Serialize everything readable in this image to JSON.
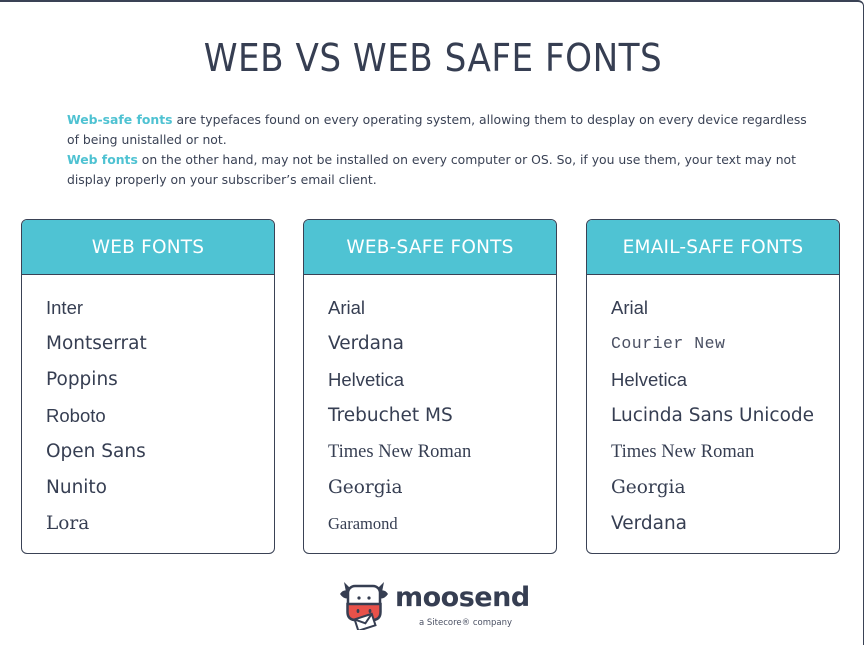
{
  "title": "WEB VS WEB SAFE FONTS",
  "intro": {
    "p1_highlight": "Web-safe fonts",
    "p1_text": " are typefaces found on every operating system, allowing them to desplay on every device regardless of being unistalled or not.",
    "p2_highlight": "Web fonts",
    "p2_text": " on the other hand, may not be installed on every computer or OS. So, if you use them, your text may not display properly on your subscriber’s email client."
  },
  "colors": {
    "accent": "#4fc3d3",
    "text": "#363e52",
    "logo_red": "#e8514a"
  },
  "cards": [
    {
      "heading": "WEB FONTS",
      "fonts": [
        "Inter",
        "Montserrat",
        "Poppins",
        "Roboto",
        "Open Sans",
        "Nunito",
        "Lora"
      ]
    },
    {
      "heading": "WEB-SAFE FONTS",
      "fonts": [
        "Arial",
        "Verdana",
        "Helvetica",
        "Trebuchet MS",
        "Times New Roman",
        "Georgia",
        "Garamond"
      ]
    },
    {
      "heading": "EMAIL-SAFE FONTS",
      "fonts": [
        "Arial",
        "Courier New",
        "Helvetica",
        "Lucinda Sans Unicode",
        "Times New Roman",
        "Georgia",
        "Verdana"
      ]
    }
  ],
  "brand": {
    "icon": "cow-mascot-icon",
    "name": "moosend",
    "tagline": "a Sitecore® company"
  }
}
